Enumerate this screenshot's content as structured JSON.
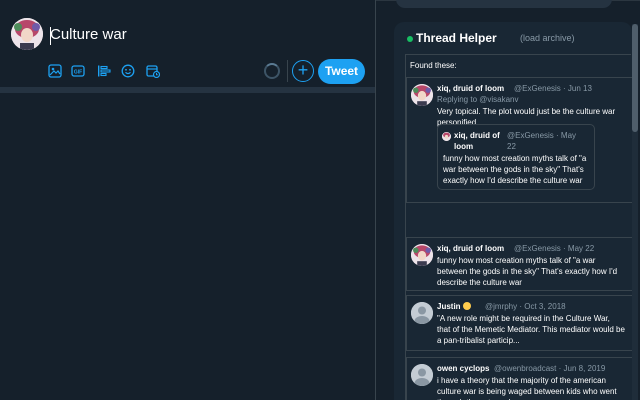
{
  "compose": {
    "text": "Culture war",
    "tweet_label": "Tweet",
    "plus_label": "+",
    "tools": [
      "image-icon",
      "gif-icon",
      "poll-icon",
      "emoji-icon",
      "schedule-icon"
    ]
  },
  "thread_helper": {
    "title": "Thread Helper",
    "load_archive": "(load archive)",
    "found_label": "Found these:",
    "tweets": [
      {
        "name": "xiq, druid of loom",
        "handle": "@ExGenesis",
        "date": "· Jun 13",
        "reply_to": "Replying to @visakanv",
        "body": "Very topical. The plot would just be the culture war personified",
        "quote": {
          "name": "xiq, druid of loom",
          "handle": "@ExGenesis",
          "date": "· May 22",
          "body": "funny how most creation myths talk of \"a war between the gods in the sky\" That's exactly how I'd describe the culture war"
        }
      },
      {
        "name": "xiq, druid of loom",
        "handle": "@ExGenesis",
        "date": "· May 22",
        "body": "funny how most creation myths talk of \"a war between the gods in the sky\" That's exactly how I'd describe the culture war"
      },
      {
        "name": "Justin",
        "handle": "@jmrphy",
        "date": "· Oct 3, 2018",
        "body": "\"A new role might be required in the Culture War, that of the Memetic Mediator. This mediator would be a pan-tribalist particip..."
      },
      {
        "name": "owen cyclops",
        "handle": "@owenbroadcast",
        "date": "· Jun 8, 2019",
        "body": "i have a theory that the majority of the american culture war is being waged between kids who went through the extremely..."
      }
    ]
  },
  "colors": {
    "background": "#15202b",
    "panel": "#192734",
    "accent": "#1da1f2",
    "border": "#38444d",
    "muted": "#8899a6",
    "status": "#17bf63"
  }
}
